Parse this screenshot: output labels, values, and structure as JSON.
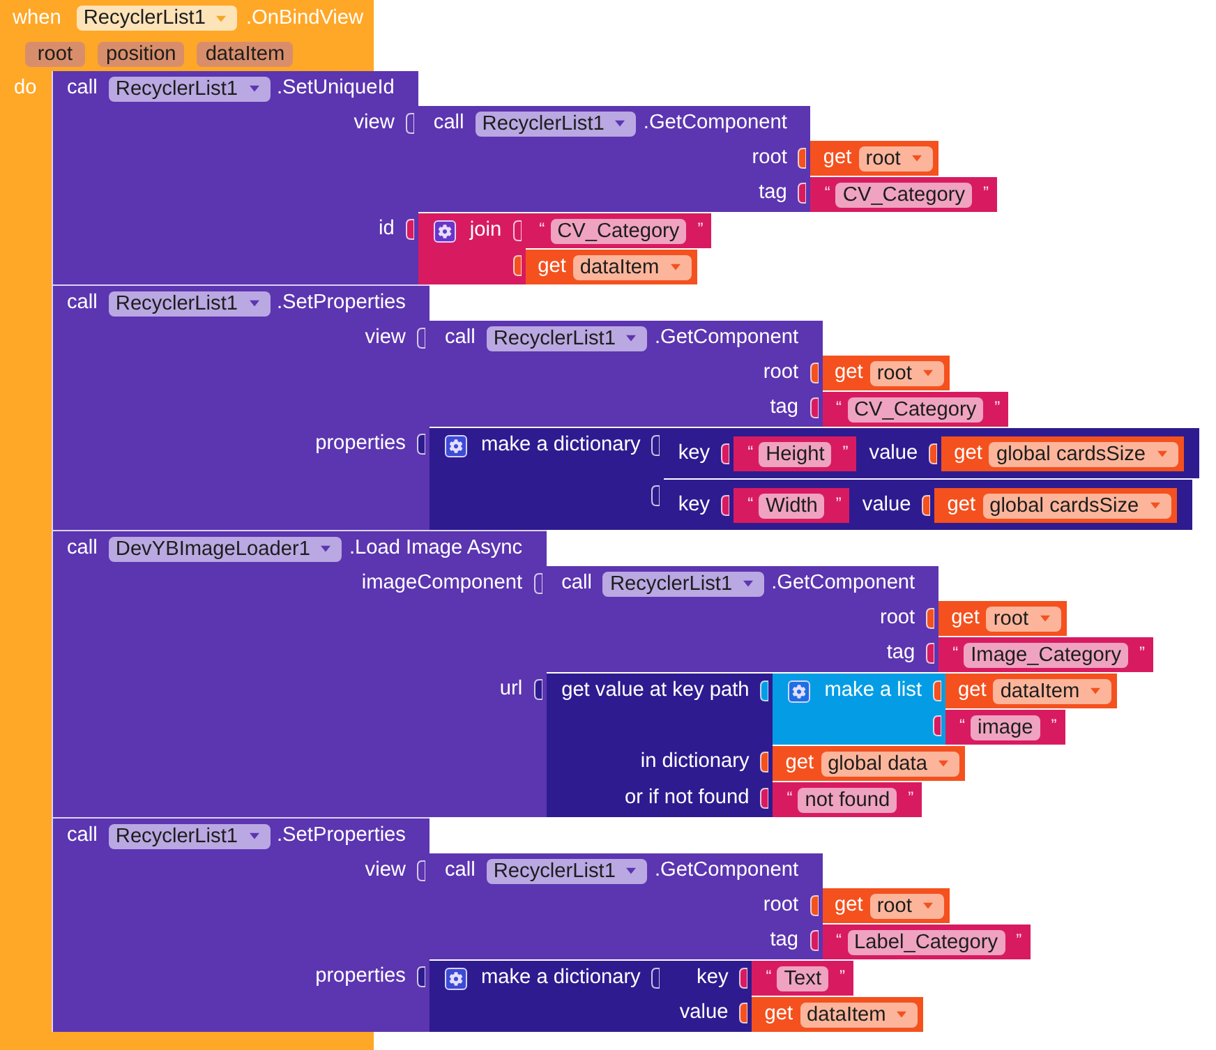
{
  "event_block": {
    "keyword": "when",
    "component": "RecyclerList1",
    "event": ".OnBindView",
    "params": [
      "root",
      "position",
      "dataItem"
    ],
    "do_label": "do",
    "statements": [
      {
        "kind": "call",
        "keyword": "call",
        "component": "RecyclerList1",
        "method": ".SetUniqueId",
        "args": [
          {
            "label": "view",
            "block": {
              "kind": "call",
              "keyword": "call",
              "component": "RecyclerList1",
              "method": ".GetComponent",
              "args": [
                {
                  "label": "root",
                  "block": {
                    "kind": "get",
                    "keyword": "get",
                    "name": "root"
                  }
                },
                {
                  "label": "tag",
                  "block": {
                    "kind": "text",
                    "quotes": [
                      "“",
                      "”"
                    ],
                    "value": "CV_Category"
                  }
                }
              ]
            }
          },
          {
            "label": "id",
            "block": {
              "kind": "join",
              "label": "join",
              "args": [
                {
                  "block": {
                    "kind": "text",
                    "quotes": [
                      "“",
                      "”"
                    ],
                    "value": "CV_Category"
                  }
                },
                {
                  "block": {
                    "kind": "get",
                    "keyword": "get",
                    "name": "dataItem"
                  }
                }
              ]
            }
          }
        ]
      },
      {
        "kind": "call",
        "keyword": "call",
        "component": "RecyclerList1",
        "method": ".SetProperties",
        "args": [
          {
            "label": "view",
            "block": {
              "kind": "call",
              "keyword": "call",
              "component": "RecyclerList1",
              "method": ".GetComponent",
              "args": [
                {
                  "label": "root",
                  "block": {
                    "kind": "get",
                    "keyword": "get",
                    "name": "root"
                  }
                },
                {
                  "label": "tag",
                  "block": {
                    "kind": "text",
                    "quotes": [
                      "“",
                      "”"
                    ],
                    "value": "CV_Category"
                  }
                }
              ]
            }
          },
          {
            "label": "properties",
            "block": {
              "kind": "dictionary",
              "label": "make a dictionary",
              "args": [
                {
                  "block": {
                    "kind": "pair",
                    "inline": true,
                    "args": [
                      {
                        "label": "key",
                        "block": {
                          "kind": "text",
                          "quotes": [
                            "“",
                            "”"
                          ],
                          "value": "Height"
                        }
                      },
                      {
                        "label": "value",
                        "block": {
                          "kind": "get",
                          "keyword": "get",
                          "name": "global cardsSize"
                        }
                      }
                    ]
                  }
                },
                {
                  "block": {
                    "kind": "pair",
                    "inline": true,
                    "args": [
                      {
                        "label": "key",
                        "block": {
                          "kind": "text",
                          "quotes": [
                            "“",
                            "”"
                          ],
                          "value": "Width"
                        }
                      },
                      {
                        "label": "value",
                        "block": {
                          "kind": "get",
                          "keyword": "get",
                          "name": "global cardsSize"
                        }
                      }
                    ]
                  }
                }
              ]
            }
          }
        ]
      },
      {
        "kind": "call",
        "keyword": "call",
        "component": "DevYBImageLoader1",
        "method": ".Load Image Async",
        "args": [
          {
            "label": "imageComponent",
            "block": {
              "kind": "call",
              "keyword": "call",
              "component": "RecyclerList1",
              "method": ".GetComponent",
              "args": [
                {
                  "label": "root",
                  "block": {
                    "kind": "get",
                    "keyword": "get",
                    "name": "root"
                  }
                },
                {
                  "label": "tag",
                  "block": {
                    "kind": "text",
                    "quotes": [
                      "“",
                      "”"
                    ],
                    "value": "Image_Category"
                  }
                }
              ]
            }
          },
          {
            "label": "url",
            "block": {
              "kind": "lookup",
              "args": [
                {
                  "label": "get value at key path",
                  "block": {
                    "kind": "list",
                    "label": "make a list",
                    "args": [
                      {
                        "block": {
                          "kind": "get",
                          "keyword": "get",
                          "name": "dataItem"
                        }
                      },
                      {
                        "block": {
                          "kind": "text",
                          "quotes": [
                            "“",
                            "”"
                          ],
                          "value": "image"
                        }
                      }
                    ]
                  }
                },
                {
                  "label": "in dictionary",
                  "block": {
                    "kind": "get",
                    "keyword": "get",
                    "name": "global data"
                  }
                },
                {
                  "label": "or if not found",
                  "block": {
                    "kind": "text",
                    "quotes": [
                      "“",
                      "”"
                    ],
                    "value": "not found"
                  }
                }
              ]
            }
          }
        ]
      },
      {
        "kind": "call",
        "keyword": "call",
        "component": "RecyclerList1",
        "method": ".SetProperties",
        "args": [
          {
            "label": "view",
            "block": {
              "kind": "call",
              "keyword": "call",
              "component": "RecyclerList1",
              "method": ".GetComponent",
              "args": [
                {
                  "label": "root",
                  "block": {
                    "kind": "get",
                    "keyword": "get",
                    "name": "root"
                  }
                },
                {
                  "label": "tag",
                  "block": {
                    "kind": "text",
                    "quotes": [
                      "“",
                      "”"
                    ],
                    "value": "Label_Category"
                  }
                }
              ]
            }
          },
          {
            "label": "properties",
            "block": {
              "kind": "dictionary",
              "label": "make a dictionary",
              "args": [
                {
                  "block": {
                    "kind": "pair",
                    "inline": false,
                    "args": [
                      {
                        "label": "key",
                        "block": {
                          "kind": "text",
                          "quotes": [
                            "“",
                            "”"
                          ],
                          "value": "Text"
                        }
                      },
                      {
                        "label": "value",
                        "block": {
                          "kind": "get",
                          "keyword": "get",
                          "name": "dataItem"
                        }
                      }
                    ]
                  }
                }
              ]
            }
          }
        ]
      }
    ]
  }
}
